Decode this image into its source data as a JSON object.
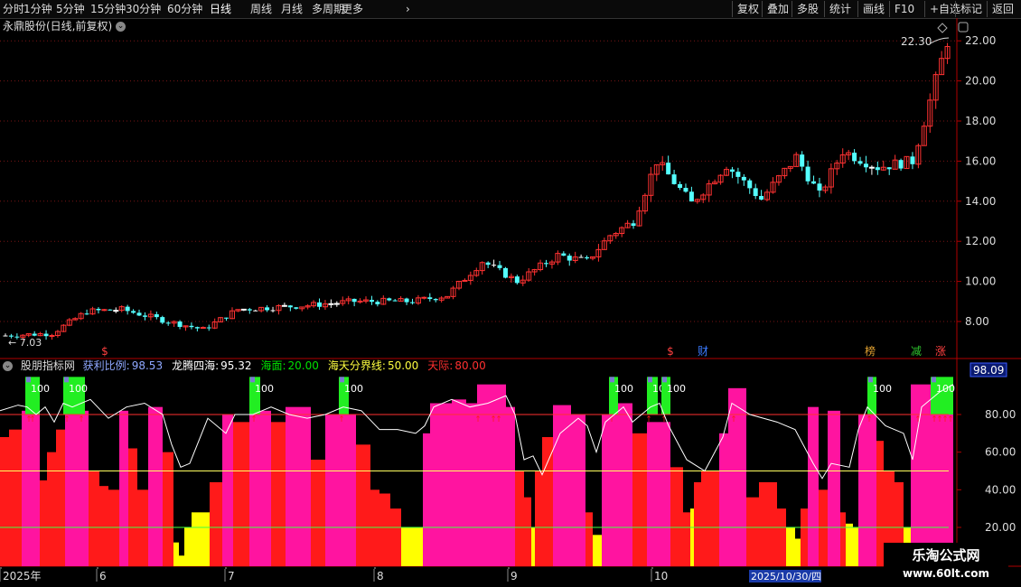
{
  "toolbar": {
    "period_tabs": [
      "分时",
      "1分钟",
      "5分钟",
      "15分钟",
      "30分钟",
      "60分钟",
      "日线",
      "周线",
      "月线",
      "多周期",
      "更多"
    ],
    "active_tab": "日线",
    "more_chevron": "chevron-right-icon",
    "right_buttons": [
      "复权",
      "叠加",
      "多股",
      "统计",
      "画线",
      "F10",
      "+自选",
      "返回"
    ]
  },
  "main_chart": {
    "title": "永鼎股份(日线,前复权)",
    "price_ticks": [
      "22.00",
      "20.00",
      "18.00",
      "16.00",
      "14.00",
      "12.00",
      "10.00",
      "8.00"
    ],
    "high_label": "22.30",
    "low_label": "7.03",
    "event_markers": [
      {
        "text": "$",
        "color": "#ff4040"
      },
      {
        "text": "$",
        "color": "#ff4040"
      },
      {
        "text": "财",
        "color": "#3a7bff"
      },
      {
        "text": "榜",
        "color": "#e0a030"
      },
      {
        "text": "减",
        "color": "#2ec42e"
      },
      {
        "text": "涨",
        "color": "#ff4040"
      }
    ],
    "colors": {
      "up": "#ff3232",
      "down": "#54ffff",
      "flat": "#ffffff",
      "grid": "#7a1414",
      "axis": "#b00000"
    }
  },
  "indicator": {
    "name": "股朋指标网",
    "items": [
      {
        "label": "获利比例:",
        "value": "98.53",
        "color": "#8fa8ff"
      },
      {
        "label": "龙腾四海:",
        "value": "95.32",
        "color": "#ffffff"
      },
      {
        "label": "海面:",
        "value": "20.00",
        "color": "#00e000"
      },
      {
        "label": "海天分界线:",
        "value": "50.00",
        "color": "#ffff40"
      },
      {
        "label": "天际:",
        "value": "80.00",
        "color": "#ff3030"
      }
    ],
    "current_value": "98.09",
    "ticks": [
      "80.00",
      "60.00",
      "40.00",
      "20.00"
    ],
    "signal_label": "100",
    "colors": {
      "red": "#ff1a1a",
      "pink": "#ff14a0",
      "yellow": "#ffff00",
      "green": "#22ee22",
      "white_line": "#ffffff",
      "sky": "#ff3030",
      "divide": "#ffff60",
      "sea": "#40ff40"
    }
  },
  "date_axis": {
    "labels": [
      "2025年",
      "6",
      "7",
      "8",
      "9",
      "10"
    ],
    "cursor_date": "2025/10/30/四"
  },
  "watermark": {
    "line1": "乐淘公式网",
    "line2": "www.60lt.com"
  }
}
